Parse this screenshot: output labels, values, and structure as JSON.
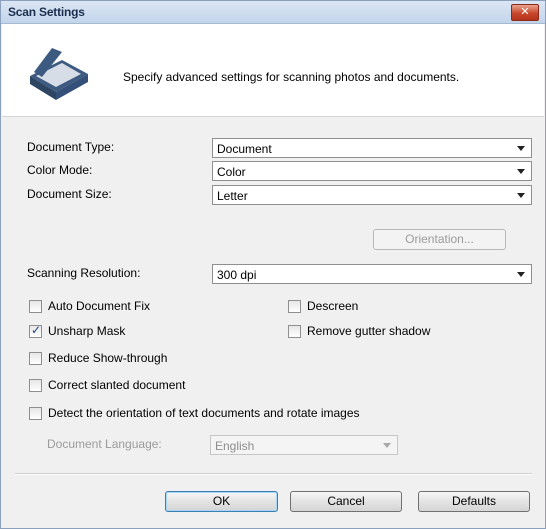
{
  "window": {
    "title": "Scan Settings",
    "close_label": "✕"
  },
  "header": {
    "description": "Specify advanced settings for scanning photos and documents."
  },
  "fields": {
    "document_type": {
      "label": "Document Type:",
      "value": "Document"
    },
    "color_mode": {
      "label": "Color Mode:",
      "value": "Color"
    },
    "document_size": {
      "label": "Document Size:",
      "value": "Letter"
    },
    "orientation_button": "Orientation...",
    "scanning_resolution": {
      "label": "Scanning Resolution:",
      "value": "300 dpi"
    }
  },
  "options": {
    "auto_document_fix": {
      "label": "Auto Document Fix",
      "checked": false
    },
    "descreen": {
      "label": "Descreen",
      "checked": false
    },
    "unsharp_mask": {
      "label": "Unsharp Mask",
      "checked": true
    },
    "remove_gutter_shadow": {
      "label": "Remove gutter shadow",
      "checked": false
    },
    "reduce_show_through": {
      "label": "Reduce Show-through",
      "checked": false
    },
    "correct_slanted_document": {
      "label": "Correct slanted document",
      "checked": false
    },
    "detect_orientation": {
      "label": "Detect the orientation of text documents and rotate images",
      "checked": false
    }
  },
  "document_language": {
    "label": "Document Language:",
    "value": "English"
  },
  "buttons": {
    "ok": "OK",
    "cancel": "Cancel",
    "defaults": "Defaults"
  },
  "checkmark_glyph": "✓"
}
